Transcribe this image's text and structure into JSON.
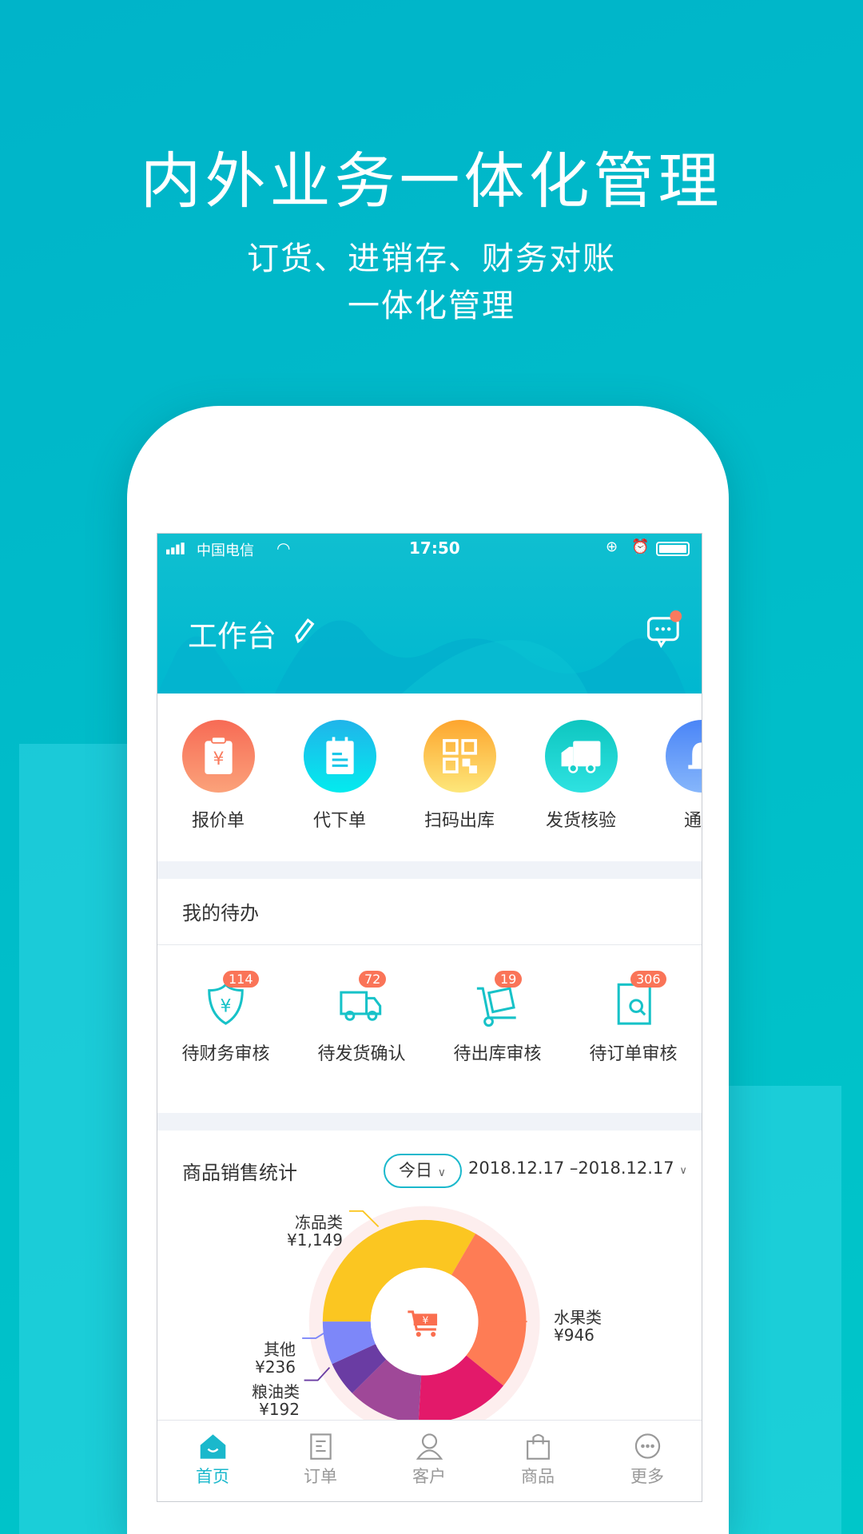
{
  "hero": {
    "title": "内外业务一体化管理",
    "subtitle_line1": "订货、进销存、财务对账",
    "subtitle_line2": "一体化管理"
  },
  "status_bar": {
    "carrier": "中国电信",
    "time": "17:50"
  },
  "header": {
    "title": "工作台",
    "icons": [
      "edit-pencil-icon",
      "message-icon"
    ],
    "has_notification_dot": true
  },
  "shortcuts": [
    {
      "label": "报价单",
      "icon": "quote-clipboard-icon",
      "color": "#f97b5e"
    },
    {
      "label": "代下单",
      "icon": "notepad-icon",
      "color": "#15c6e8"
    },
    {
      "label": "扫码出库",
      "icon": "qr-code-icon",
      "color": "#fdbd40"
    },
    {
      "label": "发货核验",
      "icon": "truck-icon",
      "color": "#17cfc9"
    },
    {
      "label": "通知",
      "icon": "bell-icon",
      "color": "#5b93f5"
    }
  ],
  "todo": {
    "title": "我的待办",
    "items": [
      {
        "label": "待财务审核",
        "count": "114",
        "icon": "shield-yen-icon"
      },
      {
        "label": "待发货确认",
        "count": "72",
        "icon": "truck-outline-icon"
      },
      {
        "label": "待出库审核",
        "count": "19",
        "icon": "cart-document-icon"
      },
      {
        "label": "待订单审核",
        "count": "306",
        "icon": "document-search-icon"
      }
    ]
  },
  "stats": {
    "title": "商品销售统计",
    "period": "今日",
    "date_range": "2018.12.17 –2018.12.17"
  },
  "chart_data": {
    "type": "pie",
    "donut": true,
    "center_icon": "shopping-cart-yen-icon",
    "slices": [
      {
        "name": "冻品类",
        "label": "¥1,149",
        "value": 1149,
        "color": "#fbc621"
      },
      {
        "name": "水果类",
        "label": "¥946",
        "value": 946,
        "color": "#fe7c55"
      },
      {
        "value": 520,
        "color": "#e3196a"
      },
      {
        "value": 400,
        "color": "#9f4898"
      },
      {
        "name": "粮油类",
        "label": "¥192",
        "value": 192,
        "color": "#6a3ca3"
      },
      {
        "name": "其他",
        "label": "¥236",
        "value": 236,
        "color": "#7d87f9"
      }
    ]
  },
  "tabbar": [
    {
      "label": "首页",
      "icon": "home-icon",
      "active": true
    },
    {
      "label": "订单",
      "icon": "order-icon"
    },
    {
      "label": "客户",
      "icon": "user-icon"
    },
    {
      "label": "商品",
      "icon": "bag-icon"
    },
    {
      "label": "更多",
      "icon": "more-icon"
    }
  ]
}
